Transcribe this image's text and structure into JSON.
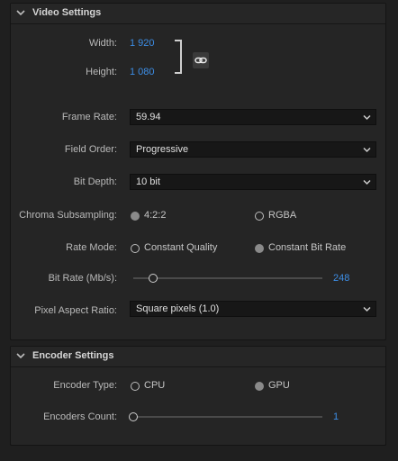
{
  "video_settings": {
    "title": "Video Settings",
    "width_label": "Width:",
    "width_value": "1 920",
    "height_label": "Height:",
    "height_value": "1 080",
    "link_icon": "chain-link-icon",
    "frame_rate_label": "Frame Rate:",
    "frame_rate_value": "59.94",
    "field_order_label": "Field Order:",
    "field_order_value": "Progressive",
    "bit_depth_label": "Bit Depth:",
    "bit_depth_value": "10 bit",
    "chroma_label": "Chroma Subsampling:",
    "chroma_options": [
      "4:2:2",
      "RGBA"
    ],
    "chroma_selected": "4:2:2",
    "rate_mode_label": "Rate Mode:",
    "rate_mode_options": [
      "Constant Quality",
      "Constant Bit Rate"
    ],
    "rate_mode_selected": "Constant Bit Rate",
    "bit_rate_label": "Bit Rate (Mb/s):",
    "bit_rate_value": "248",
    "pixel_aspect_label": "Pixel Aspect Ratio:",
    "pixel_aspect_value": "Square pixels (1.0)"
  },
  "encoder_settings": {
    "title": "Encoder Settings",
    "encoder_type_label": "Encoder Type:",
    "encoder_type_options": [
      "CPU",
      "GPU"
    ],
    "encoder_type_selected": "GPU",
    "encoders_count_label": "Encoders Count:",
    "encoders_count_value": "1"
  },
  "colors": {
    "accent": "#3d8ee6",
    "panel": "#252525",
    "background": "#1f1f1f"
  }
}
